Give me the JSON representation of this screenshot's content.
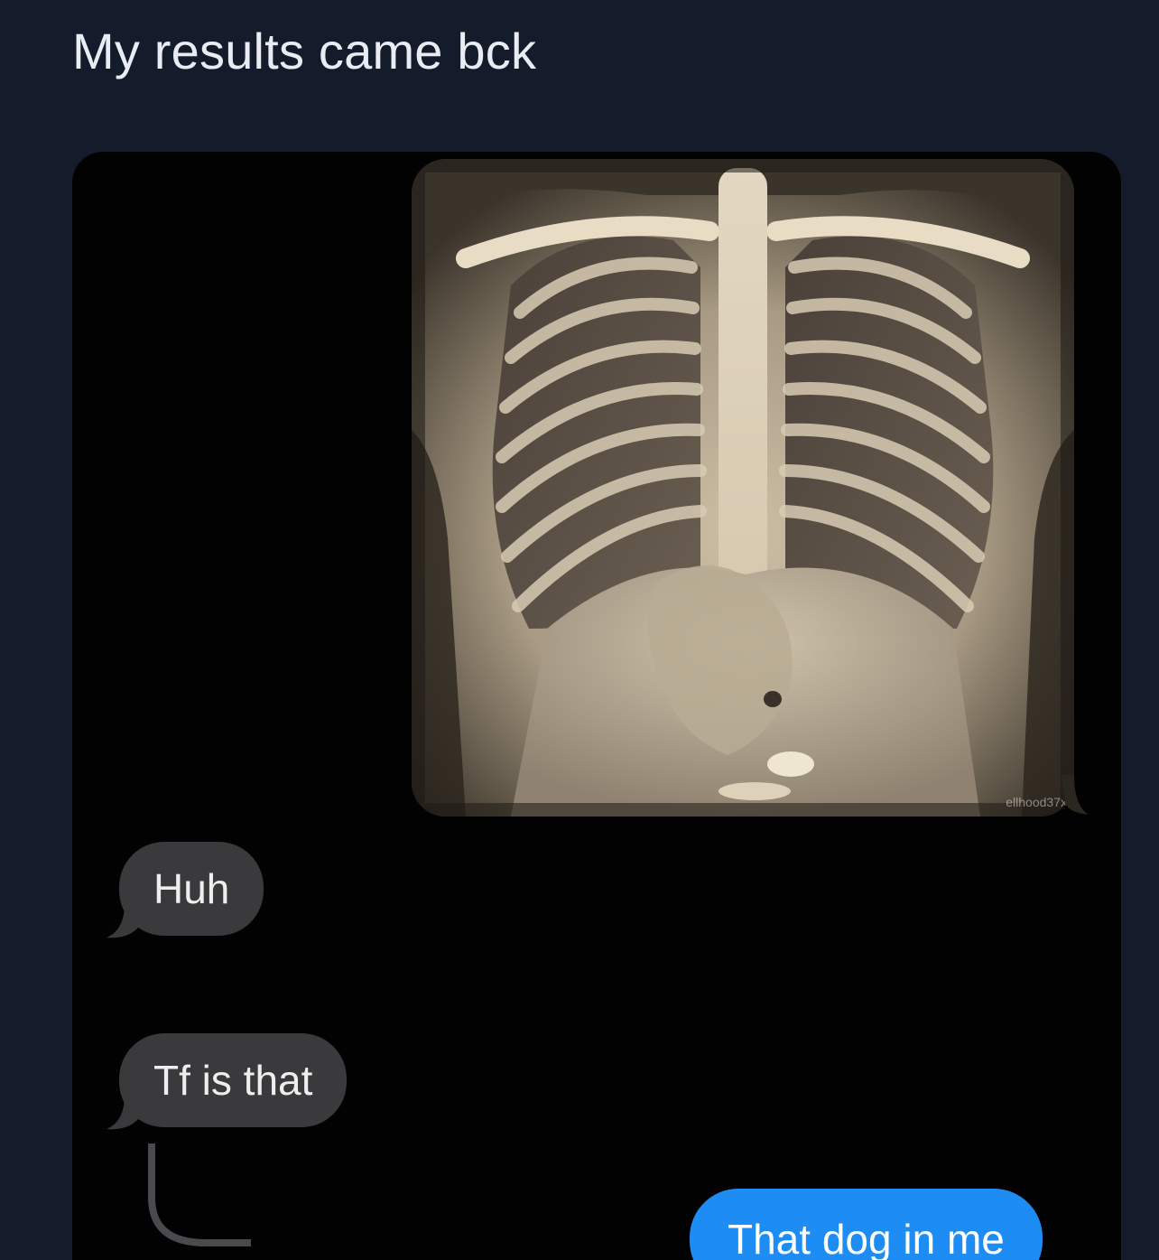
{
  "post": {
    "caption": "My results came bck"
  },
  "conversation": {
    "image_watermark": "ellhood37x",
    "received": [
      {
        "text": "Huh"
      },
      {
        "text": "Tf is that"
      }
    ],
    "sent": [
      {
        "text": "That dog in me"
      }
    ]
  },
  "colors": {
    "page_background": "#141b2a",
    "chat_background": "#020203",
    "received_bubble": "#3a3a3d",
    "sent_bubble": "#1e8cf5",
    "caption_text": "#e9ecf2"
  },
  "icons": {
    "xray_image": "chest-xray-photo",
    "reply_thread": "reply-thread-line"
  }
}
